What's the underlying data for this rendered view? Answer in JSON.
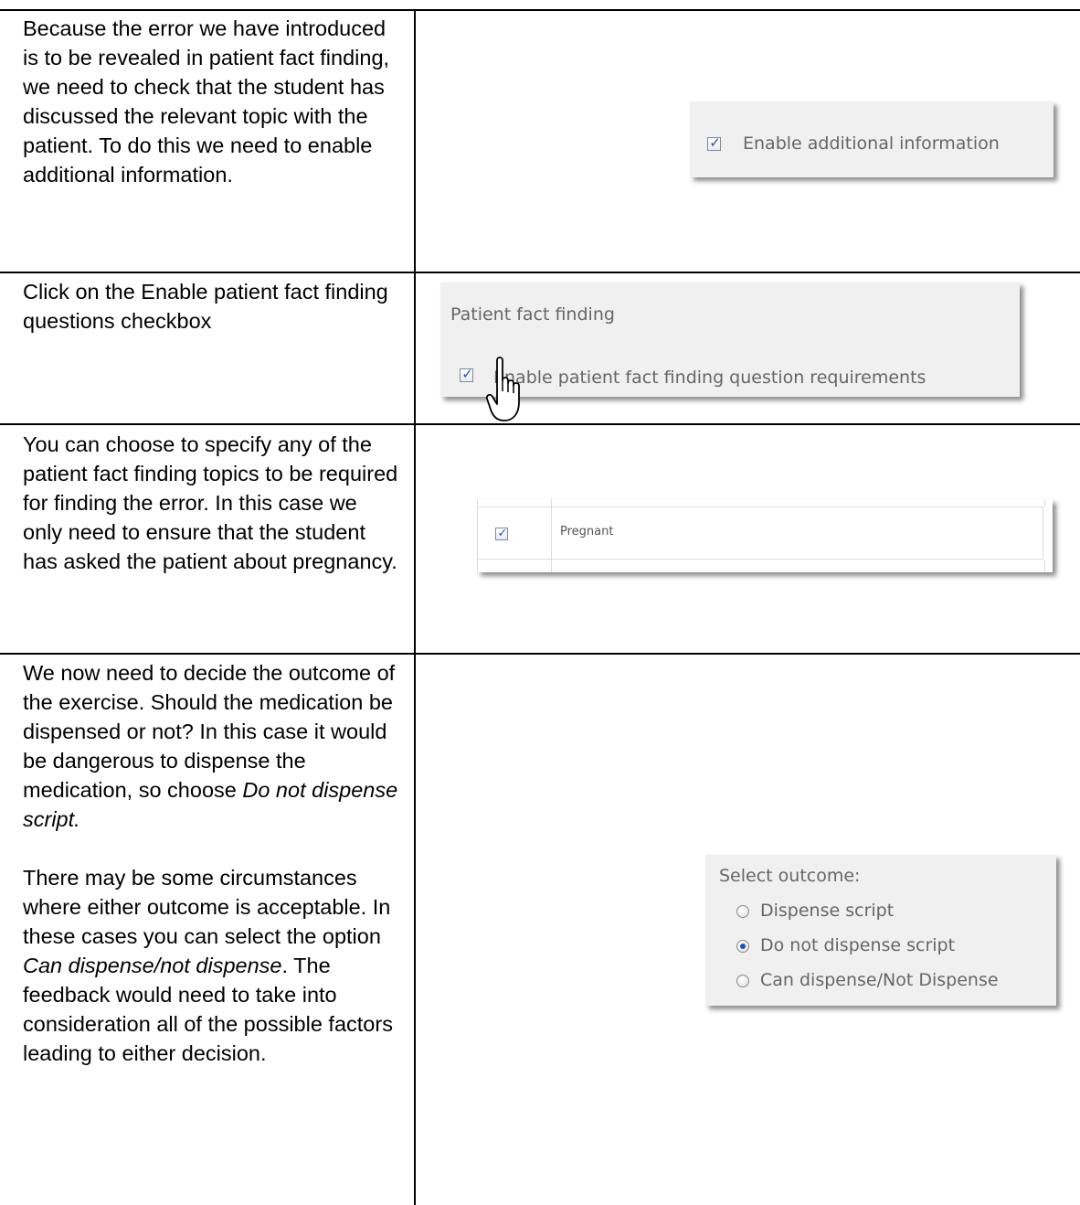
{
  "rows": [
    {
      "text": "Because the error we have introduced is to be revealed in patient fact finding, we need to check that the student has discussed the relevant topic with the patient. To do this we need to enable additional information.",
      "screenshot": {
        "checkbox_label": "Enable additional information",
        "checked": true
      }
    },
    {
      "text": "Click on the Enable patient fact finding questions checkbox",
      "screenshot": {
        "section_title": "Patient fact finding",
        "checkbox_label": "Enable patient fact finding question requirements",
        "checked": true,
        "cursor": "hand-pointer-icon"
      }
    },
    {
      "text": "You can choose to specify any of the patient fact finding topics to be required for finding the error. In this case we only need to ensure that the student has asked the patient about pregnancy.",
      "screenshot": {
        "topic_label": "Pregnant",
        "checked": true
      }
    },
    {
      "paragraph1_a": "We now need to decide the outcome of the exercise. Should the medication be dispensed or not? In this case it would be dangerous to dispense the medication, so choose ",
      "paragraph1_em": "Do not dispense script.",
      "paragraph2_a": "There may be some circumstances where either outcome is acceptable. In these cases you can select the option ",
      "paragraph2_em1": "Can dispense/not dispense",
      "paragraph2_b": ". The feedback would need to take into consideration all of the possible factors leading to either decision.",
      "screenshot": {
        "title": "Select outcome:",
        "options": [
          "Dispense script",
          "Do not dispense script",
          "Can dispense/Not Dispense"
        ],
        "selected": "Do not dispense script"
      }
    }
  ]
}
